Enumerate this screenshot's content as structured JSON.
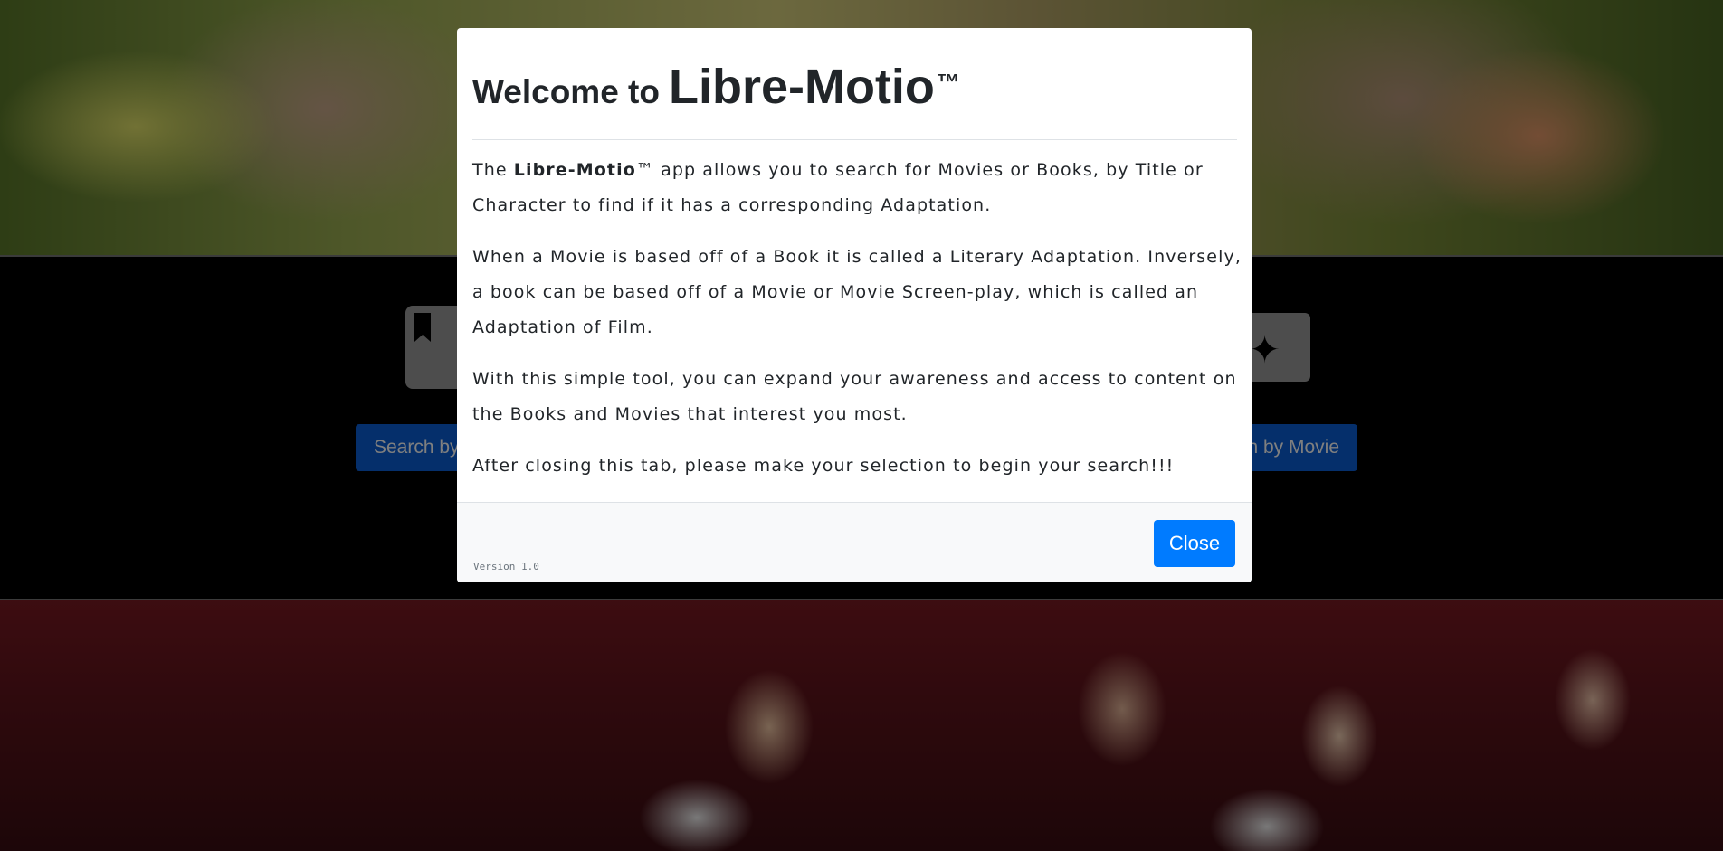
{
  "background": {
    "search_book_label": "Search by Book",
    "search_movie_label": "Search by Movie",
    "book_icon": "bookmark-book-icon",
    "film_icon": "film-star-icon"
  },
  "modal": {
    "title_prefix": "Welcome to",
    "title_brand": "Libre-Motio",
    "title_tm": "™",
    "paragraphs": {
      "p1_lead": "The ",
      "p1_brand": "Libre-Motio",
      "p1_rest": "™ app allows you to search for Movies or Books, by Title or Character to find if it has a corresponding Adaptation.",
      "p2": "When a Movie is based off of a Book it is called a Literary Adaptation. Inversely, a book can be based off of a Movie or Movie Screen-play, which is called an Adaptation of Film.",
      "p3": "With this simple tool, you can expand your awareness and access to content on the Books and Movies that interest you most.",
      "p4": "After closing this tab, please make your selection to begin your search!!!"
    },
    "version": "Version 1.0",
    "close_label": "Close"
  },
  "colors": {
    "primary": "#007bff",
    "footer_bg": "#f8f9fa",
    "text": "#212529"
  }
}
